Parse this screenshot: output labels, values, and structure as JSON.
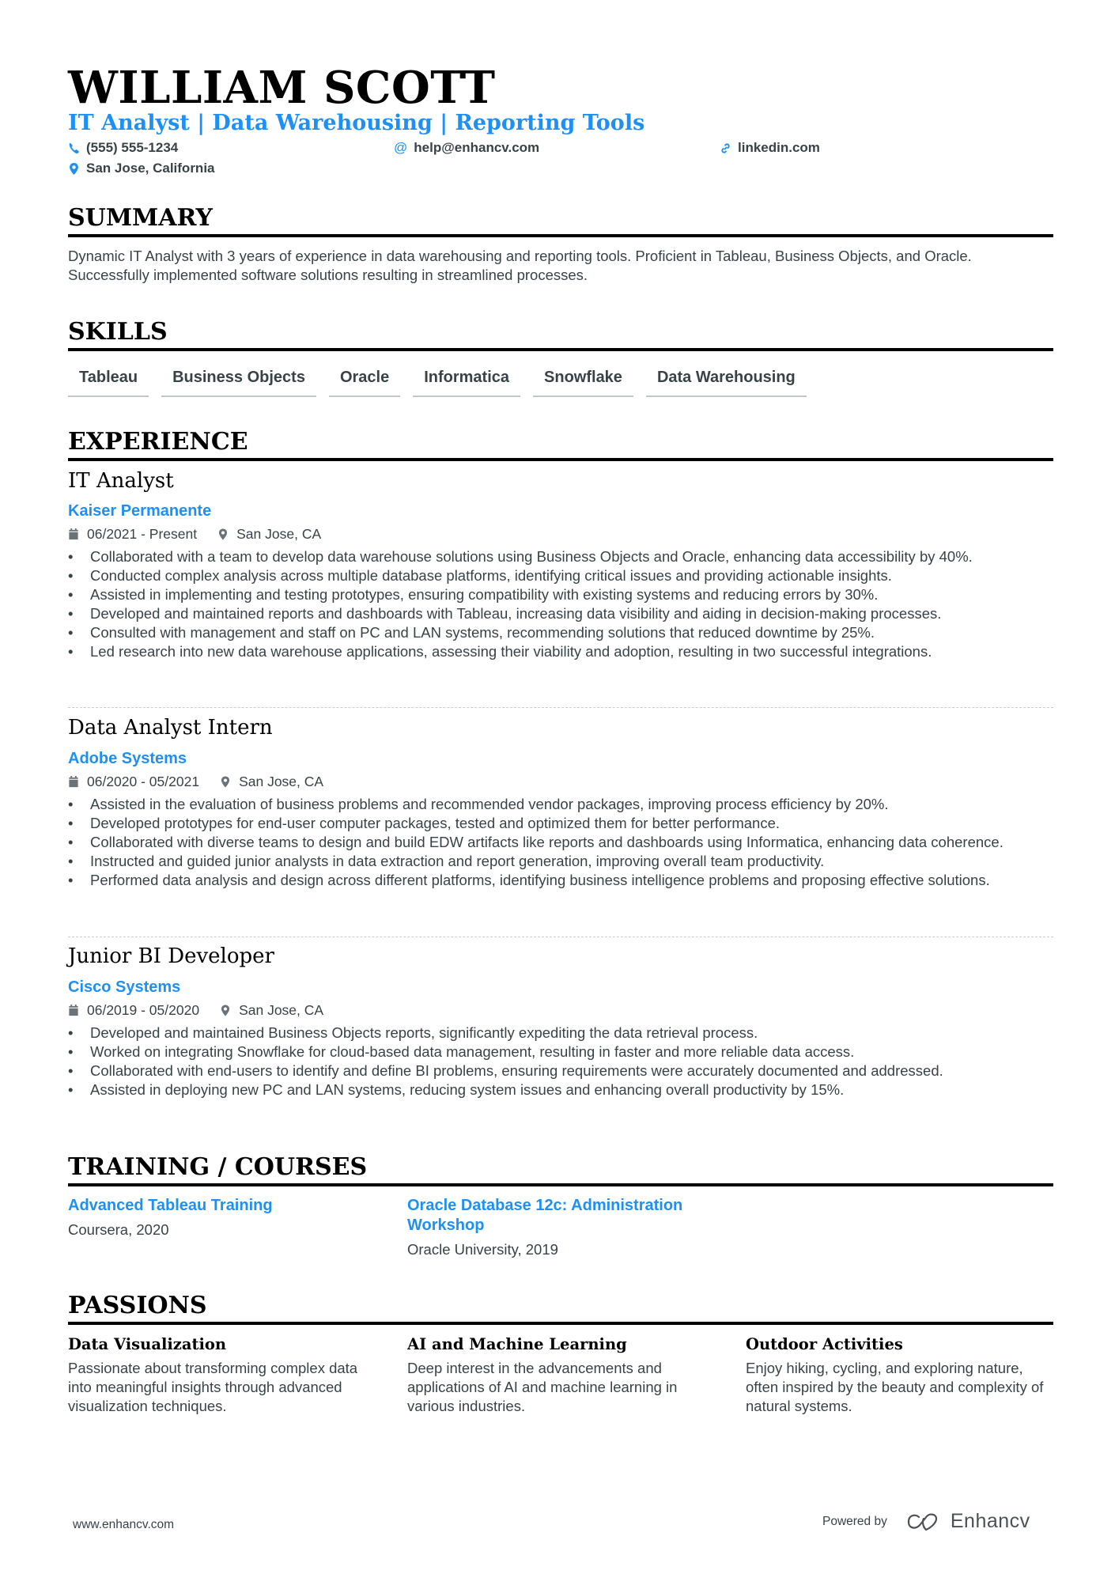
{
  "header": {
    "name": "WILLIAM SCOTT",
    "title": "IT Analyst | Data Warehousing | Reporting Tools",
    "phone": "(555) 555-1234",
    "email": "help@enhancv.com",
    "linkedin": "linkedin.com",
    "location": "San Jose, California"
  },
  "summary": {
    "heading": "SUMMARY",
    "text": "Dynamic IT Analyst with 3 years of experience in data warehousing and reporting tools. Proficient in Tableau, Business Objects, and Oracle. Successfully implemented software solutions resulting in streamlined processes."
  },
  "skills": {
    "heading": "SKILLS",
    "items": [
      "Tableau",
      "Business Objects",
      "Oracle",
      "Informatica",
      "Snowflake",
      "Data Warehousing"
    ]
  },
  "experience": {
    "heading": "EXPERIENCE",
    "jobs": [
      {
        "title": "IT Analyst",
        "company": "Kaiser Permanente",
        "dates": "06/2021 - Present",
        "location": "San Jose, CA",
        "bullets": [
          "Collaborated with a team to develop data warehouse solutions using Business Objects and Oracle, enhancing data accessibility by 40%.",
          "Conducted complex analysis across multiple database platforms, identifying critical issues and providing actionable insights.",
          "Assisted in implementing and testing prototypes, ensuring compatibility with existing systems and reducing errors by 30%.",
          "Developed and maintained reports and dashboards with Tableau, increasing data visibility and aiding in decision-making processes.",
          "Consulted with management and staff on PC and LAN systems, recommending solutions that reduced downtime by 25%.",
          "Led research into new data warehouse applications, assessing their viability and adoption, resulting in two successful integrations."
        ]
      },
      {
        "title": "Data Analyst Intern",
        "company": "Adobe Systems",
        "dates": "06/2020 - 05/2021",
        "location": "San Jose, CA",
        "bullets": [
          "Assisted in the evaluation of business problems and recommended vendor packages, improving process efficiency by 20%.",
          "Developed prototypes for end-user computer packages, tested and optimized them for better performance.",
          "Collaborated with diverse teams to design and build EDW artifacts like reports and dashboards using Informatica, enhancing data coherence.",
          "Instructed and guided junior analysts in data extraction and report generation, improving overall team productivity.",
          "Performed data analysis and design across different platforms, identifying business intelligence problems and proposing effective solutions."
        ]
      },
      {
        "title": "Junior BI Developer",
        "company": "Cisco Systems",
        "dates": "06/2019 - 05/2020",
        "location": "San Jose, CA",
        "bullets": [
          "Developed and maintained Business Objects reports, significantly expediting the data retrieval process.",
          "Worked on integrating Snowflake for cloud-based data management, resulting in faster and more reliable data access.",
          "Collaborated with end-users to identify and define BI problems, ensuring requirements were accurately documented and addressed.",
          "Assisted in deploying new PC and LAN systems, reducing system issues and enhancing overall productivity by 15%."
        ]
      }
    ]
  },
  "training": {
    "heading": "TRAINING / COURSES",
    "items": [
      {
        "title": "Advanced Tableau Training",
        "provider": "Coursera, 2020"
      },
      {
        "title": "Oracle Database 12c: Administration Workshop",
        "provider": "Oracle University, 2019"
      }
    ]
  },
  "passions": {
    "heading": "PASSIONS",
    "items": [
      {
        "title": "Data Visualization",
        "text": "Passionate about transforming complex data into meaningful insights through advanced visualization techniques."
      },
      {
        "title": "AI and Machine Learning",
        "text": "Deep interest in the advancements and applications of AI and machine learning in various industries."
      },
      {
        "title": "Outdoor Activities",
        "text": "Enjoy hiking, cycling, and exploring nature, often inspired by the beauty and complexity of natural systems."
      }
    ]
  },
  "footer": {
    "website": "www.enhancv.com",
    "powered_by": "Powered by",
    "brand": "Enhancv"
  },
  "colors": {
    "accent": "#1e90f3",
    "text": "#384347",
    "heading": "#000000"
  }
}
